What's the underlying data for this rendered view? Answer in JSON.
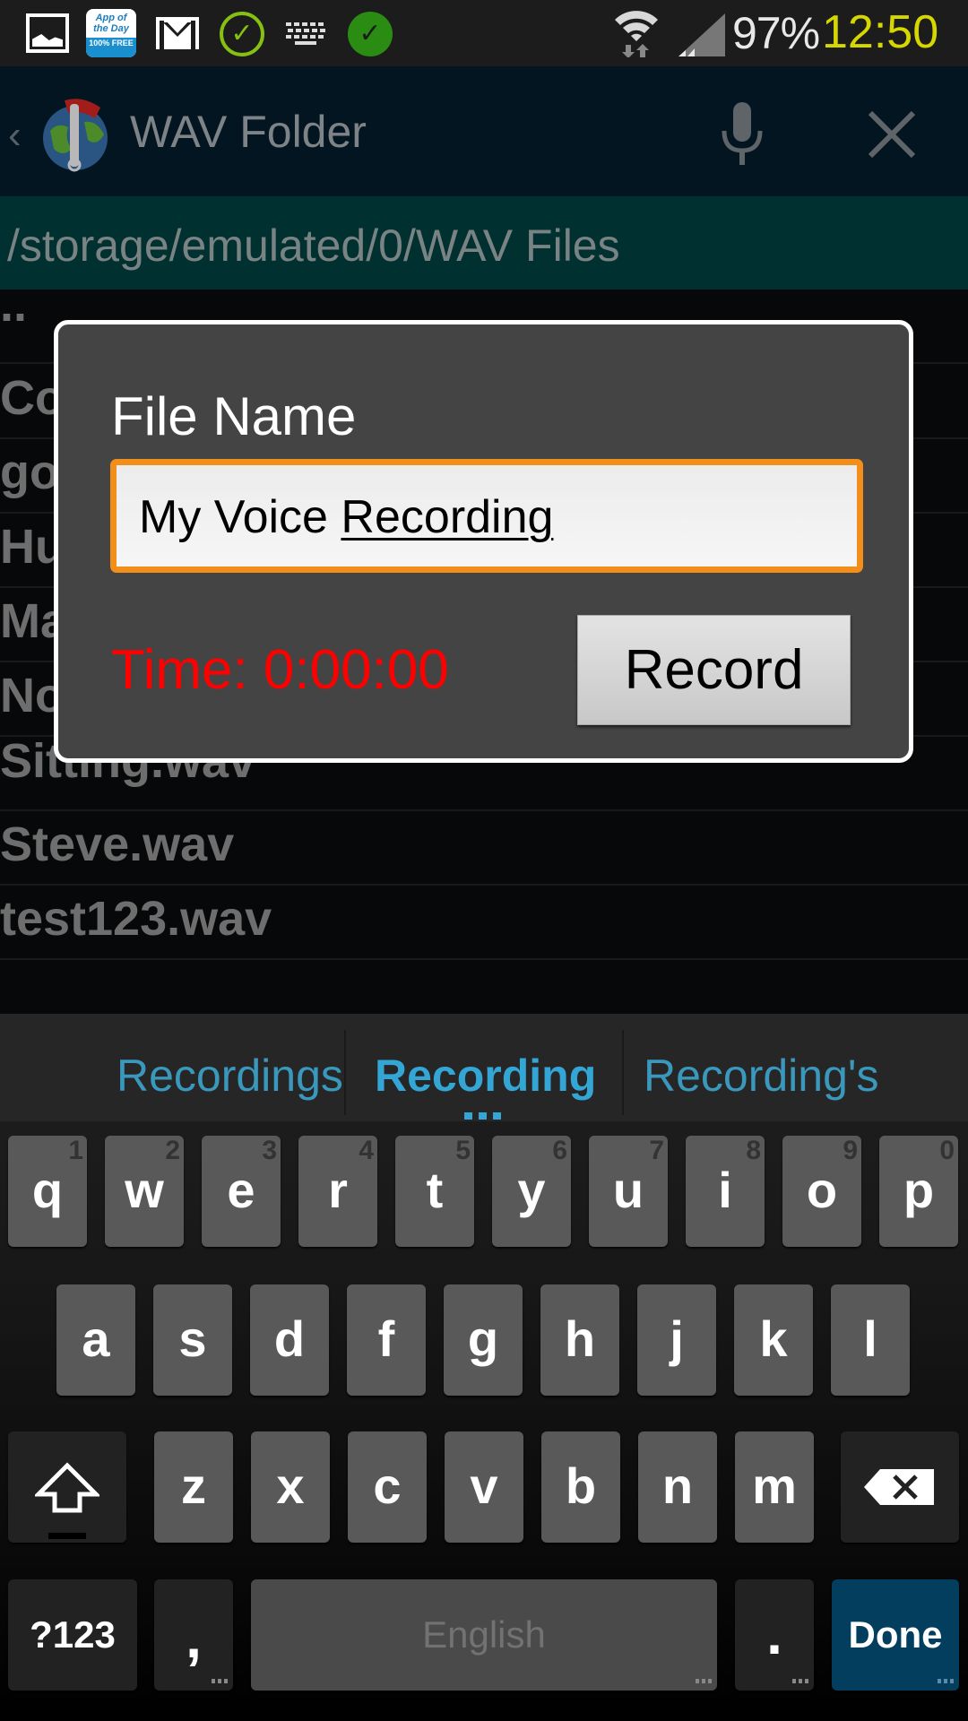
{
  "status_bar": {
    "notification_icons": [
      "gallery-icon",
      "app-of-the-day-icon",
      "gmail-icon",
      "check-outline-icon",
      "keyboard-icon",
      "check-filled-icon"
    ],
    "app_of_the_day": {
      "line1": "App of",
      "line2": "the Day",
      "badge": "100% FREE"
    },
    "battery": "97%",
    "time": "12:50",
    "colors": {
      "time": "#d7d700",
      "check_outline": "#86c112",
      "check_filled": "#2b8c14"
    }
  },
  "action_bar": {
    "title": "WAV Folder",
    "back_glyph": "‹",
    "mic_icon": "microphone-icon",
    "close_icon": "close-icon"
  },
  "path_bar": {
    "path": "/storage/emulated/0/WAV Files"
  },
  "file_list": {
    "items": [
      {
        "name": ".."
      },
      {
        "name": "Co"
      },
      {
        "name": "go"
      },
      {
        "name": "Hu"
      },
      {
        "name": "Ma"
      },
      {
        "name": "No"
      },
      {
        "name": "Sitting.wav"
      },
      {
        "name": "Steve.wav"
      },
      {
        "name": "test123.wav"
      }
    ]
  },
  "dialog": {
    "label": "File Name",
    "input": {
      "value_prefix": "My Voice ",
      "value_composing": "Recording",
      "value": "My Voice Recording"
    },
    "time_label": "Time: 0:00:00",
    "record_button": "Record",
    "colors": {
      "input_border": "#f28f1b",
      "time": "#ff0000"
    }
  },
  "keyboard": {
    "suggestions": [
      {
        "text": "Recordings",
        "primary": false
      },
      {
        "text": "Recording",
        "primary": true
      },
      {
        "text": "Recording's",
        "primary": false
      }
    ],
    "row1": [
      {
        "key": "q",
        "hint": "1"
      },
      {
        "key": "w",
        "hint": "2"
      },
      {
        "key": "e",
        "hint": "3"
      },
      {
        "key": "r",
        "hint": "4"
      },
      {
        "key": "t",
        "hint": "5"
      },
      {
        "key": "y",
        "hint": "6"
      },
      {
        "key": "u",
        "hint": "7"
      },
      {
        "key": "i",
        "hint": "8"
      },
      {
        "key": "o",
        "hint": "9"
      },
      {
        "key": "p",
        "hint": "0"
      }
    ],
    "row2": [
      "a",
      "s",
      "d",
      "f",
      "g",
      "h",
      "j",
      "k",
      "l"
    ],
    "row3": [
      "z",
      "x",
      "c",
      "v",
      "b",
      "n",
      "m"
    ],
    "shift_icon": "shift-arrow-icon",
    "backspace_icon": "backspace-icon",
    "symbols_key": "?123",
    "comma_key": ",",
    "space_key": "English",
    "period_key": ".",
    "done_key": "Done",
    "colors": {
      "accent": "#33a6d6",
      "done_bg": "#033e5e"
    }
  }
}
